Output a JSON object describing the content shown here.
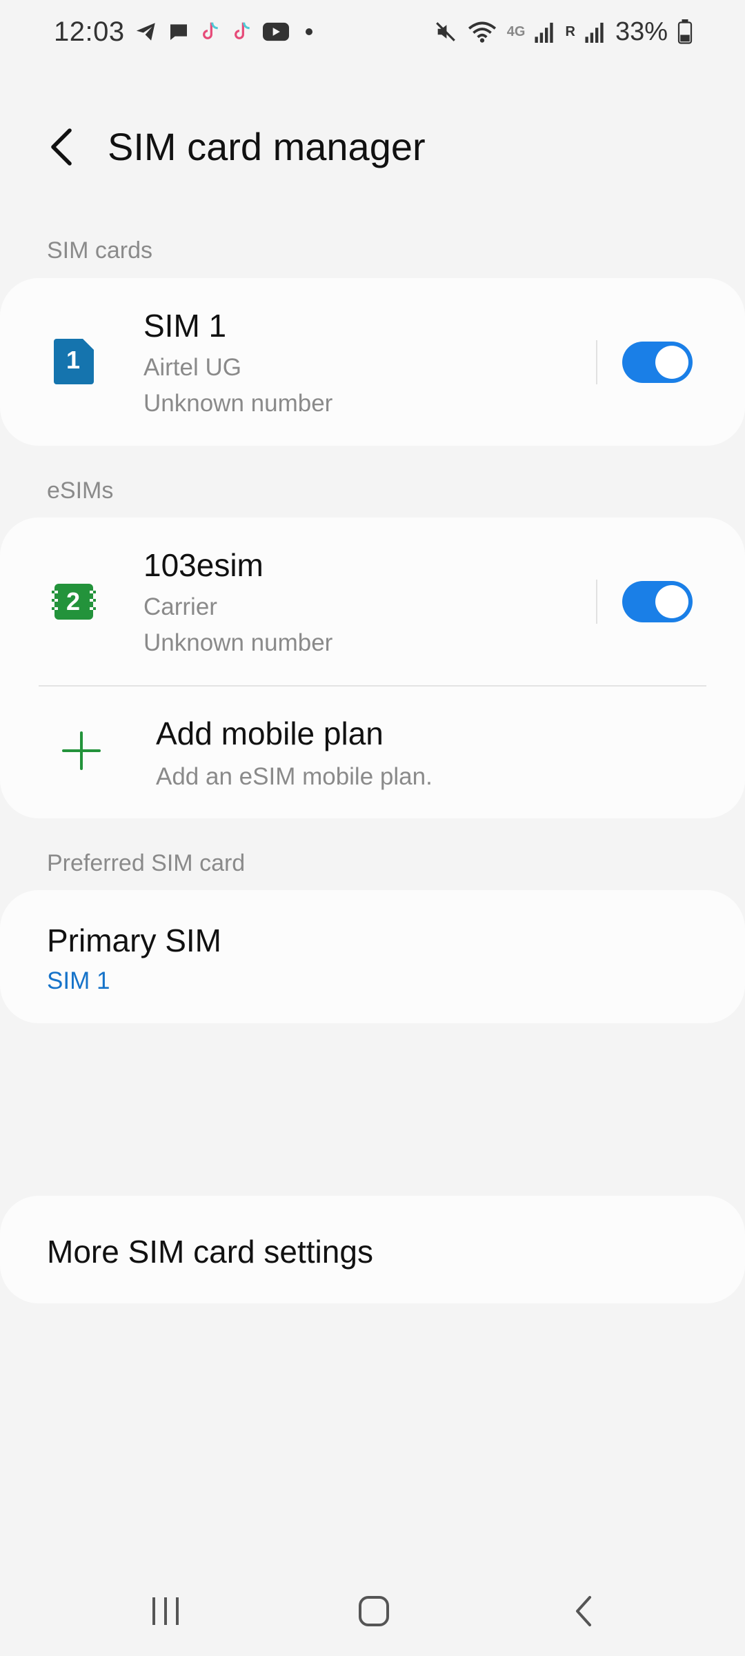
{
  "status_bar": {
    "time": "12:03",
    "notification_icons": [
      "telegram-icon",
      "message-icon",
      "tiktok-icon",
      "tiktok-icon",
      "youtube-icon",
      "more-dot-icon"
    ],
    "network_label": "4G",
    "roaming_label": "R",
    "battery_percent": "33%"
  },
  "header": {
    "title": "SIM card manager",
    "back_icon": "back-arrow-icon"
  },
  "sections": {
    "sim_cards_label": "SIM cards",
    "esims_label": "eSIMs",
    "preferred_label": "Preferred SIM card"
  },
  "sim_cards": [
    {
      "badge": "1",
      "name": "SIM 1",
      "carrier": "Airtel UG",
      "number": "Unknown number",
      "enabled": true,
      "badge_color": "#1574ae"
    }
  ],
  "esims": [
    {
      "badge": "2",
      "name": "103esim",
      "carrier": "Carrier",
      "number": "Unknown number",
      "enabled": true,
      "badge_color": "#23933b"
    }
  ],
  "add_plan": {
    "title": "Add mobile plan",
    "subtitle": "Add an eSIM mobile plan."
  },
  "preferred": {
    "title": "Primary SIM",
    "value": "SIM 1"
  },
  "more_settings": {
    "title": "More SIM card settings"
  },
  "colors": {
    "accent": "#1a7fe7",
    "link": "#1673c9",
    "plus": "#23933b"
  }
}
